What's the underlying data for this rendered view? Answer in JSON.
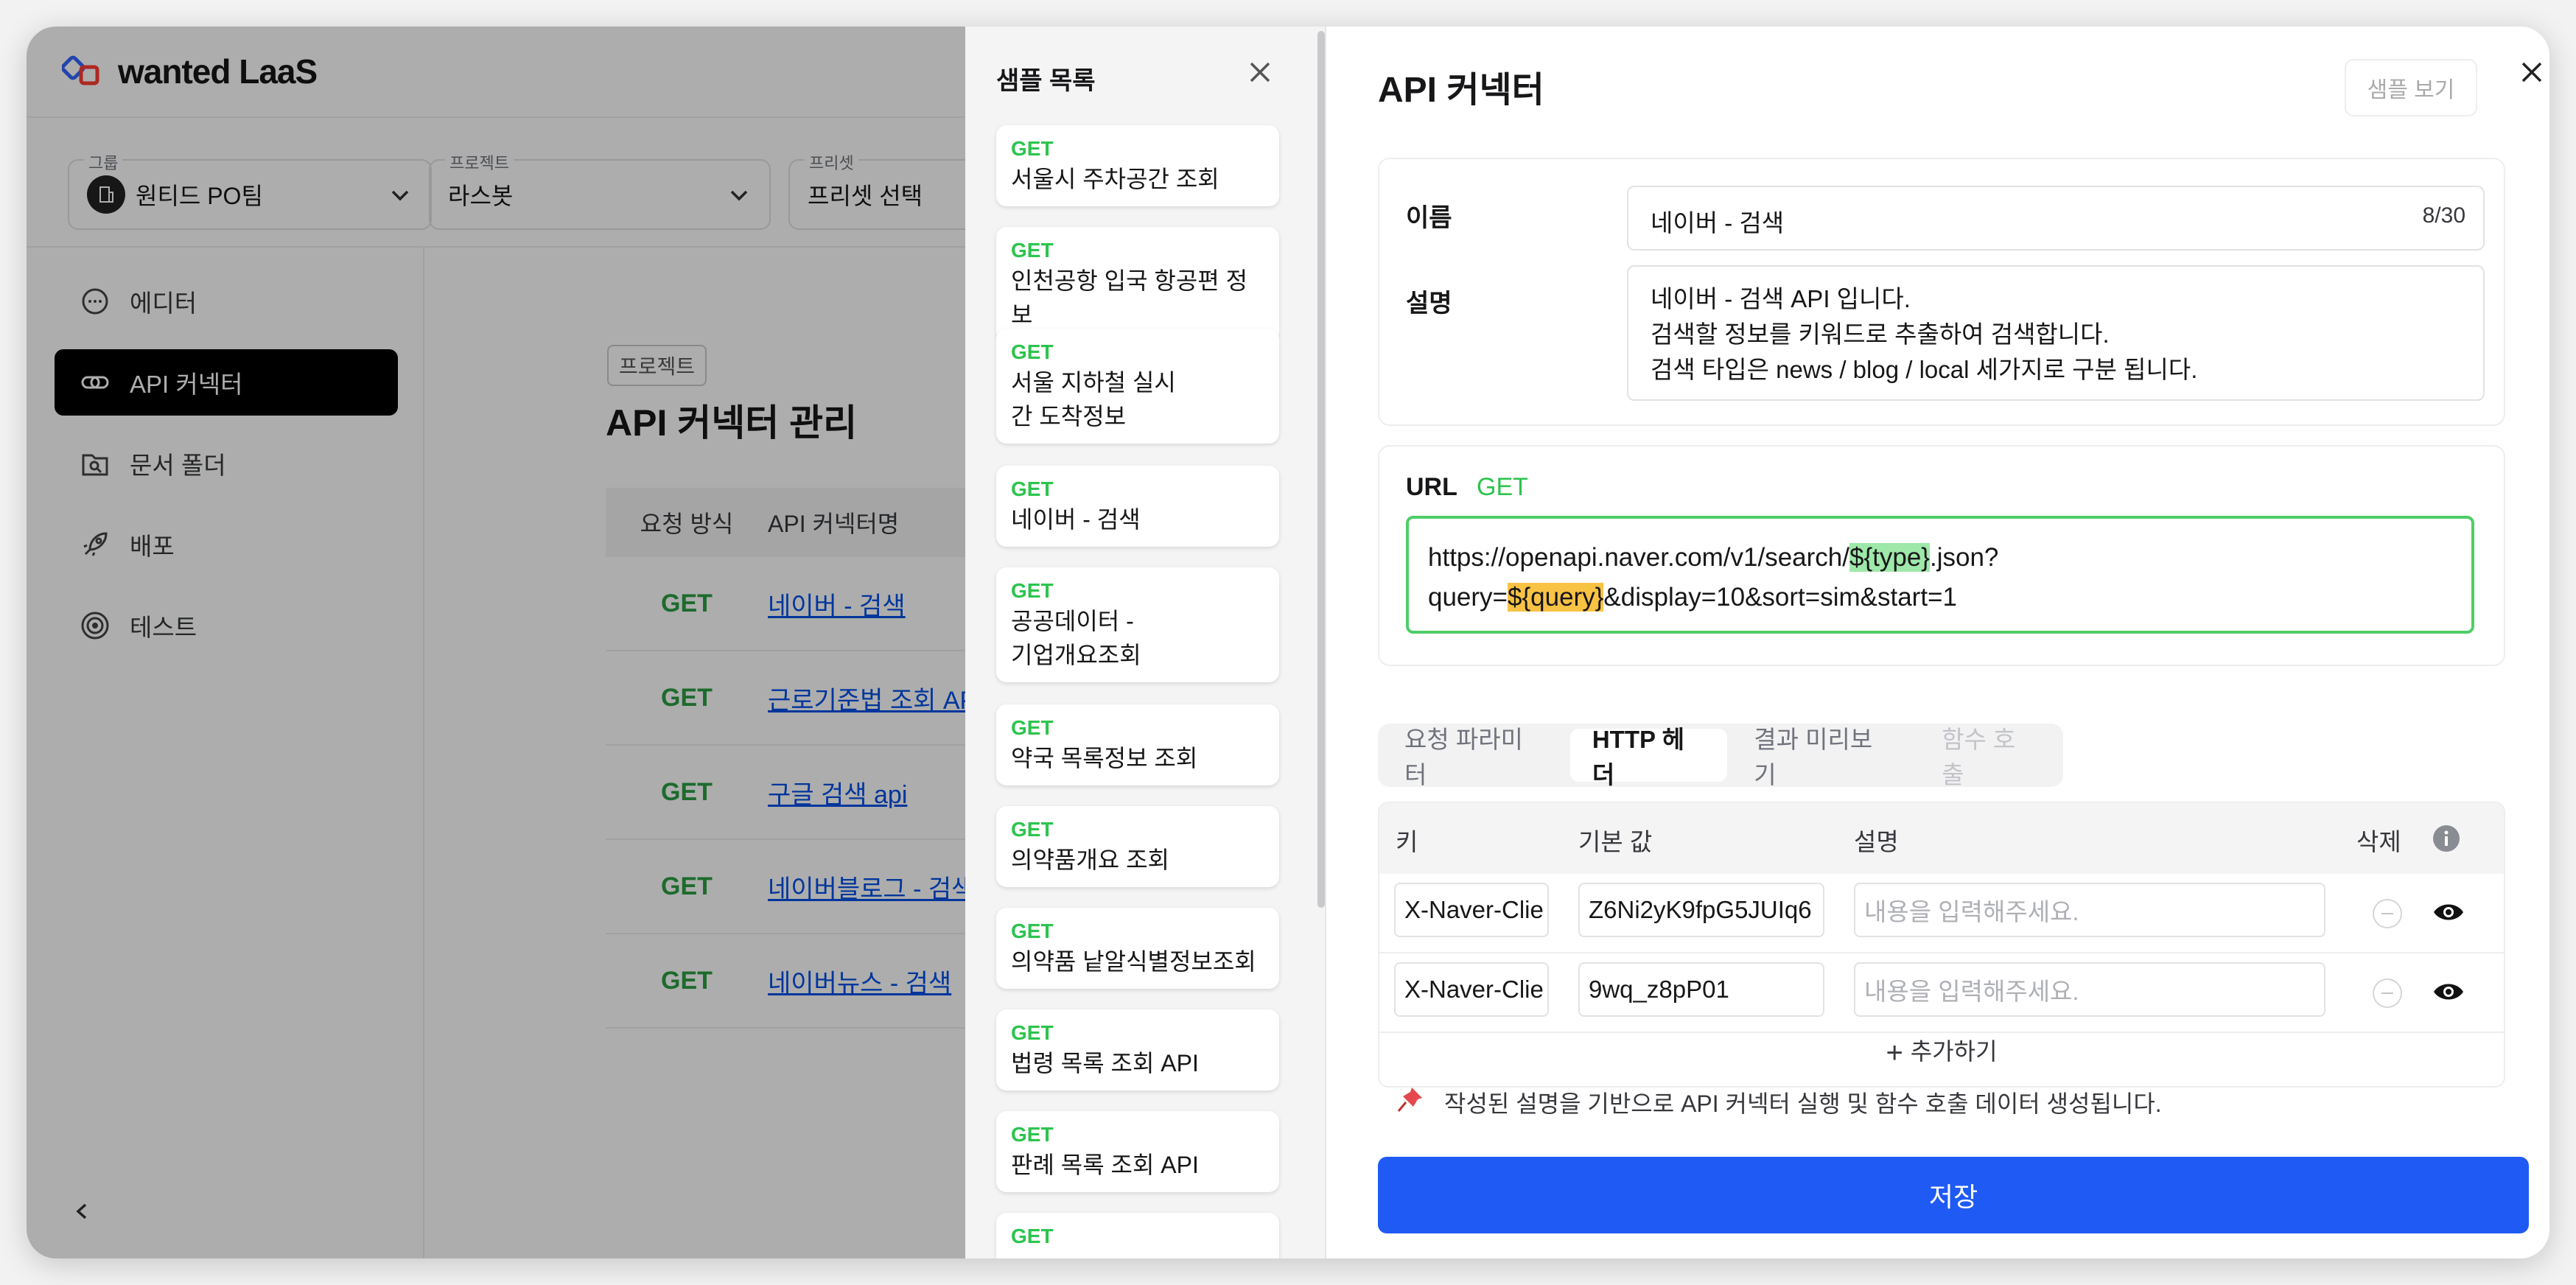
{
  "brand": {
    "logo_text": "wanted LaaS"
  },
  "selectors": [
    {
      "label": "그룹",
      "value": "원티드 PO팀"
    },
    {
      "label": "프로젝트",
      "value": "라스봇"
    },
    {
      "label": "프리셋",
      "value": "프리셋 선택"
    }
  ],
  "sidebar": {
    "items": [
      {
        "label": "에디터",
        "icon": "chat-bubble-icon"
      },
      {
        "label": "API 커넥터",
        "icon": "link-icon",
        "active": true
      },
      {
        "label": "문서 폴더",
        "icon": "folder-search-icon"
      },
      {
        "label": "배포",
        "icon": "rocket-icon"
      },
      {
        "label": "테스트",
        "icon": "target-icon"
      }
    ],
    "collapse_label": "<"
  },
  "main": {
    "badge": "프로젝트",
    "title": "API 커넥터 관리",
    "columns": [
      "요청 방식",
      "API 커넥터명"
    ],
    "rows": [
      {
        "method": "GET",
        "name": "네이버 - 검색"
      },
      {
        "method": "GET",
        "name": "근로기준법 조회 API"
      },
      {
        "method": "GET",
        "name": "구글 검색 api"
      },
      {
        "method": "GET",
        "name": "네이버블로그 - 검색"
      },
      {
        "method": "GET",
        "name": "네이버뉴스 - 검색"
      }
    ]
  },
  "samples": {
    "title": "샘플 목록",
    "items": [
      {
        "method": "GET",
        "name": "서울시 주차공간 조회"
      },
      {
        "method": "GET",
        "name": "인천공항 입국 항공편 정보"
      },
      {
        "method": "GET",
        "name": "서울 지하철 실시간 도착정보"
      },
      {
        "method": "GET",
        "name": "네이버 - 검색"
      },
      {
        "method": "GET",
        "name": "공공데이터 - 기업개요조회"
      },
      {
        "method": "GET",
        "name": "약국 목록정보 조회"
      },
      {
        "method": "GET",
        "name": "의약품개요 조회"
      },
      {
        "method": "GET",
        "name": "의약품 낱알식별정보조회"
      },
      {
        "method": "GET",
        "name": "법령 목록 조회 API"
      },
      {
        "method": "GET",
        "name": "판례 목록 조회 API"
      },
      {
        "method": "GET",
        "name": ""
      }
    ]
  },
  "connector": {
    "title": "API 커넥터",
    "sample_view_button": "샘플 보기",
    "name_label": "이름",
    "name_value": "네이버 - 검색",
    "name_counter": "8/30",
    "desc_label": "설명",
    "desc_lines": [
      "네이버 - 검색 API 입니다.",
      "검색할 정보를 키워드로 추출하여 검색합니다.",
      "검색 타입은 news / blog / local 세가지로 구분 됩니다."
    ],
    "url_label": "URL",
    "url_method": "GET",
    "url": {
      "part1": "https://openapi.naver.com/v1/search/",
      "var1": "${type}",
      "part2": ".json?",
      "part3": "query=",
      "var2": "${query}",
      "part4": "&display=10&sort=sim&start=1"
    },
    "tabs": [
      {
        "label": "요청 파라미터",
        "state": "normal"
      },
      {
        "label": "HTTP 헤더",
        "state": "active"
      },
      {
        "label": "결과 미리보기",
        "state": "normal"
      },
      {
        "label": "함수 호출",
        "state": "disabled"
      }
    ],
    "header_columns": {
      "key": "키",
      "default": "기본 값",
      "desc": "설명",
      "delete": "삭제"
    },
    "header_rows": [
      {
        "key": "X-Naver-Clie",
        "default": "Z6Ni2yK9fpG5JUIq6",
        "desc_placeholder": "내용을 입력해주세요."
      },
      {
        "key": "X-Naver-Clie",
        "default": "9wq_z8pP01",
        "desc_placeholder": "내용을 입력해주세요."
      }
    ],
    "add_label": "추가하기",
    "note": "작성된 설명을 기반으로 API 커넥터 실행 및 함수 호출 데이터 생성됩니다.",
    "save_label": "저장"
  }
}
